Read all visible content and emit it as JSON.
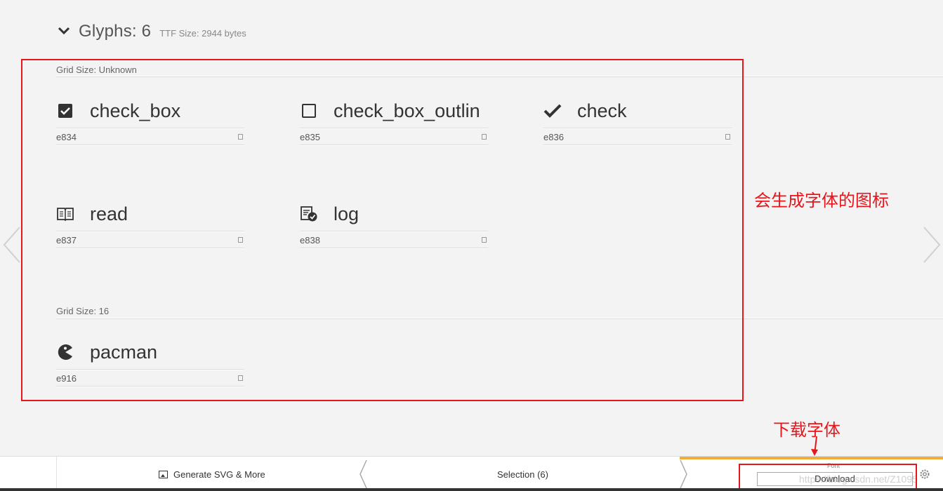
{
  "header": {
    "title": "Glyphs: 6",
    "subtitle": "TTF Size: 2944 bytes"
  },
  "sections": [
    {
      "label": "Grid Size: Unknown",
      "glyphs": [
        {
          "icon": "checked-box-icon",
          "name": "check_box",
          "code": "e834"
        },
        {
          "icon": "empty-box-icon",
          "name": "check_box_outlin",
          "code": "e835"
        },
        {
          "icon": "checkmark-icon",
          "name": "check",
          "code": "e836"
        },
        {
          "icon": "book-icon",
          "name": "read",
          "code": "e837"
        },
        {
          "icon": "log-icon",
          "name": "log",
          "code": "e838"
        }
      ]
    },
    {
      "label": "Grid Size: 16",
      "glyphs": [
        {
          "icon": "pacman-icon",
          "name": "pacman",
          "code": "e916"
        }
      ]
    }
  ],
  "annotations": {
    "glyph_note": "会生成字体的图标",
    "download_note": "下载字体"
  },
  "bottombar": {
    "generate_label": "Generate SVG & More",
    "selection_label": "Selection (6)",
    "font_caption": "Font",
    "download_label": "Download",
    "watermark": "https://blog.csdn.net/Z1095"
  },
  "colors": {
    "annotation_red": "#e8161b",
    "download_accent": "#f0ad3b"
  }
}
